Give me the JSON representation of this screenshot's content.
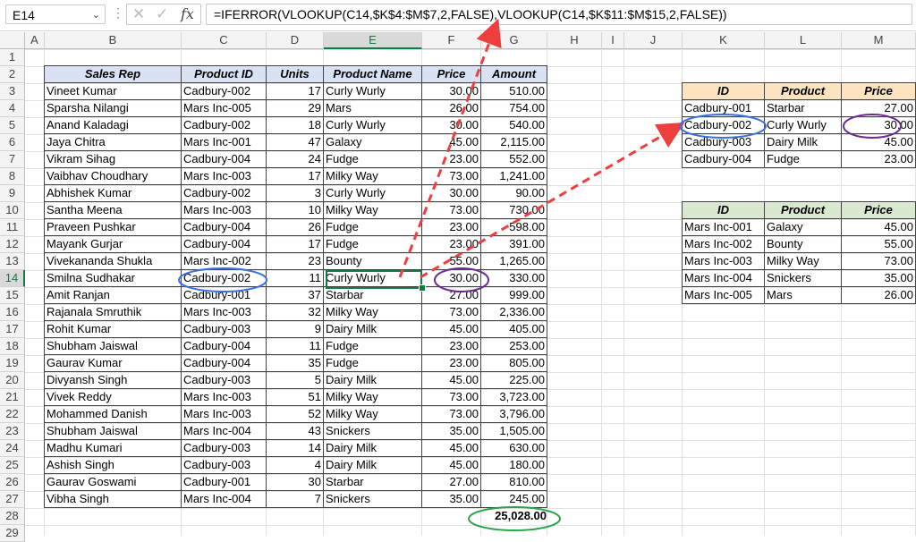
{
  "formula_bar": {
    "name_box": "E14",
    "formula": "=IFERROR(VLOOKUP(C14,$K$4:$M$7,2,FALSE),VLOOKUP(C14,$K$11:$M$15,2,FALSE))",
    "cancel_icon": "close-icon",
    "enter_icon": "check-icon",
    "function_icon": "fx-icon"
  },
  "columns": [
    "A",
    "B",
    "C",
    "D",
    "E",
    "F",
    "G",
    "H",
    "I",
    "J",
    "K",
    "L",
    "M"
  ],
  "rows": [
    "1",
    "2",
    "3",
    "4",
    "5",
    "6",
    "7",
    "8",
    "9",
    "10",
    "11",
    "12",
    "13",
    "14",
    "15",
    "16",
    "17",
    "18",
    "19",
    "20",
    "21",
    "22",
    "23",
    "24",
    "25",
    "26",
    "27",
    "28",
    "29"
  ],
  "main_table": {
    "headers": [
      "Sales Rep",
      "Product ID",
      "Units",
      "Product Name",
      "Price",
      "Amount"
    ],
    "rows": [
      [
        "Vineet Kumar",
        "Cadbury-002",
        "17",
        "Curly Wurly",
        "30.00",
        "510.00"
      ],
      [
        "Sparsha Nilangi",
        "Mars Inc-005",
        "29",
        "Mars",
        "26.00",
        "754.00"
      ],
      [
        "Anand Kaladagi",
        "Cadbury-002",
        "18",
        "Curly Wurly",
        "30.00",
        "540.00"
      ],
      [
        "Jaya Chitra",
        "Mars Inc-001",
        "47",
        "Galaxy",
        "45.00",
        "2,115.00"
      ],
      [
        "Vikram Sihag",
        "Cadbury-004",
        "24",
        "Fudge",
        "23.00",
        "552.00"
      ],
      [
        "Vaibhav Choudhary",
        "Mars Inc-003",
        "17",
        "Milky Way",
        "73.00",
        "1,241.00"
      ],
      [
        "Abhishek Kumar",
        "Cadbury-002",
        "3",
        "Curly Wurly",
        "30.00",
        "90.00"
      ],
      [
        "Santha Meena",
        "Mars Inc-003",
        "10",
        "Milky Way",
        "73.00",
        "730.00"
      ],
      [
        "Praveen Pushkar",
        "Cadbury-004",
        "26",
        "Fudge",
        "23.00",
        "598.00"
      ],
      [
        "Mayank Gurjar",
        "Cadbury-004",
        "17",
        "Fudge",
        "23.00",
        "391.00"
      ],
      [
        "Vivekananda Shukla",
        "Mars Inc-002",
        "23",
        "Bounty",
        "55.00",
        "1,265.00"
      ],
      [
        "Smilna Sudhakar",
        "Cadbury-002",
        "11",
        "Curly Wurly",
        "30.00",
        "330.00"
      ],
      [
        "Amit Ranjan",
        "Cadbury-001",
        "37",
        "Starbar",
        "27.00",
        "999.00"
      ],
      [
        "Rajanala Smruthik",
        "Mars Inc-003",
        "32",
        "Milky Way",
        "73.00",
        "2,336.00"
      ],
      [
        "Rohit Kumar",
        "Cadbury-003",
        "9",
        "Dairy Milk",
        "45.00",
        "405.00"
      ],
      [
        "Shubham Jaiswal",
        "Cadbury-004",
        "11",
        "Fudge",
        "23.00",
        "253.00"
      ],
      [
        "Gaurav Kumar",
        "Cadbury-004",
        "35",
        "Fudge",
        "23.00",
        "805.00"
      ],
      [
        "Divyansh Singh",
        "Cadbury-003",
        "5",
        "Dairy Milk",
        "45.00",
        "225.00"
      ],
      [
        "Vivek Reddy",
        "Mars Inc-003",
        "51",
        "Milky Way",
        "73.00",
        "3,723.00"
      ],
      [
        "Mohammed Danish",
        "Mars Inc-003",
        "52",
        "Milky Way",
        "73.00",
        "3,796.00"
      ],
      [
        "Shubham Jaiswal",
        "Mars Inc-004",
        "43",
        "Snickers",
        "35.00",
        "1,505.00"
      ],
      [
        "Madhu Kumari",
        "Cadbury-003",
        "14",
        "Dairy Milk",
        "45.00",
        "630.00"
      ],
      [
        "Ashish Singh",
        "Cadbury-003",
        "4",
        "Dairy Milk",
        "45.00",
        "180.00"
      ],
      [
        "Gaurav Goswami",
        "Cadbury-001",
        "30",
        "Starbar",
        "27.00",
        "810.00"
      ],
      [
        "Vibha Singh",
        "Mars Inc-004",
        "7",
        "Snickers",
        "35.00",
        "245.00"
      ]
    ],
    "total": "25,028.00"
  },
  "lookup_cadbury": {
    "headers": [
      "ID",
      "Product",
      "Price"
    ],
    "rows": [
      [
        "Cadbury-001",
        "Starbar",
        "27.00"
      ],
      [
        "Cadbury-002",
        "Curly Wurly",
        "30.00"
      ],
      [
        "Cadbury-003",
        "Dairy Milk",
        "45.00"
      ],
      [
        "Cadbury-004",
        "Fudge",
        "23.00"
      ]
    ]
  },
  "lookup_mars": {
    "headers": [
      "ID",
      "Product",
      "Price"
    ],
    "rows": [
      [
        "Mars Inc-001",
        "Galaxy",
        "45.00"
      ],
      [
        "Mars Inc-002",
        "Bounty",
        "55.00"
      ],
      [
        "Mars Inc-003",
        "Milky Way",
        "73.00"
      ],
      [
        "Mars Inc-004",
        "Snickers",
        "35.00"
      ],
      [
        "Mars Inc-005",
        "Mars",
        "26.00"
      ]
    ]
  },
  "colors": {
    "selection": "#107c41",
    "arrow": "#ee3f3f",
    "blue_circle": "#3a6fe0",
    "purple_circle": "#6a2c91",
    "green_circle": "#2aa24a"
  }
}
